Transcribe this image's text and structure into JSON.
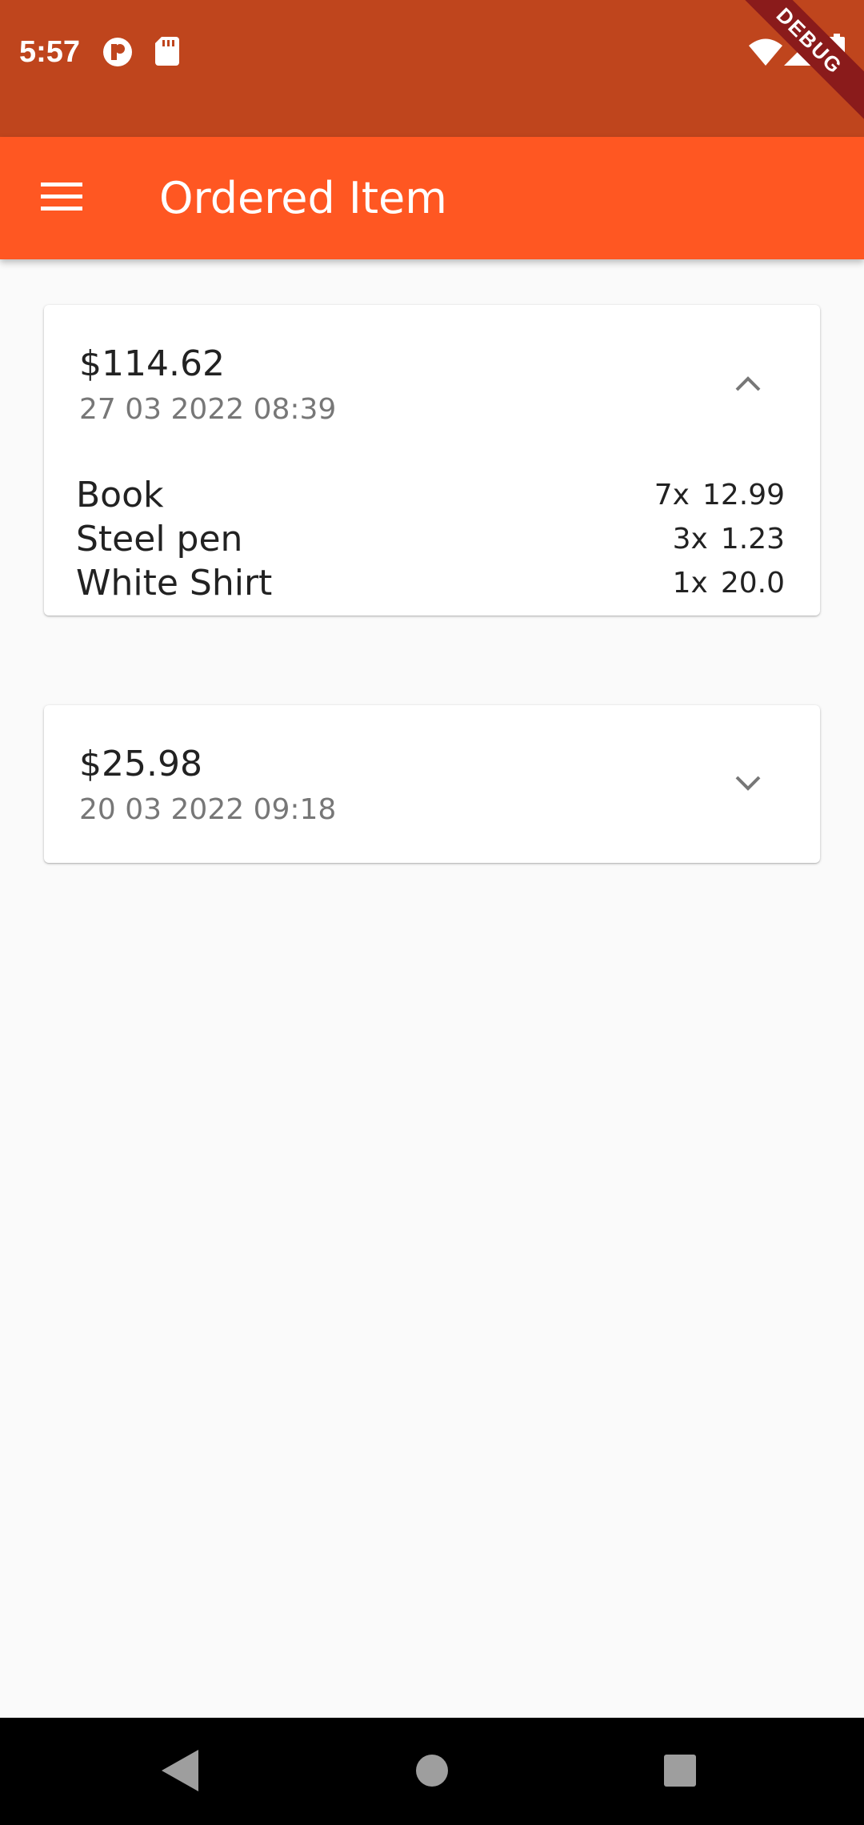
{
  "status_bar": {
    "time": "5:57",
    "debug_label": "DEBUG",
    "icons": [
      "app-notification-icon",
      "sd-card-icon",
      "wifi-icon",
      "cell-signal-icon",
      "battery-icon"
    ]
  },
  "app_bar": {
    "title": "Ordered Item",
    "menu_icon": "hamburger-menu-icon",
    "background": "#ff5722"
  },
  "orders": [
    {
      "total": "$114.62",
      "date": "27 03 2022 08:39",
      "expanded": true,
      "items": [
        {
          "name": "Book",
          "qty": "7x",
          "price": "12.99"
        },
        {
          "name": "Steel pen",
          "qty": "3x",
          "price": "1.23"
        },
        {
          "name": "White Shirt",
          "qty": "1x",
          "price": "20.0"
        }
      ]
    },
    {
      "total": "$25.98",
      "date": "20 03 2022 09:18",
      "expanded": false,
      "items": []
    }
  ],
  "nav_bar": {
    "icons": [
      "back-icon",
      "home-icon",
      "recents-icon"
    ]
  }
}
